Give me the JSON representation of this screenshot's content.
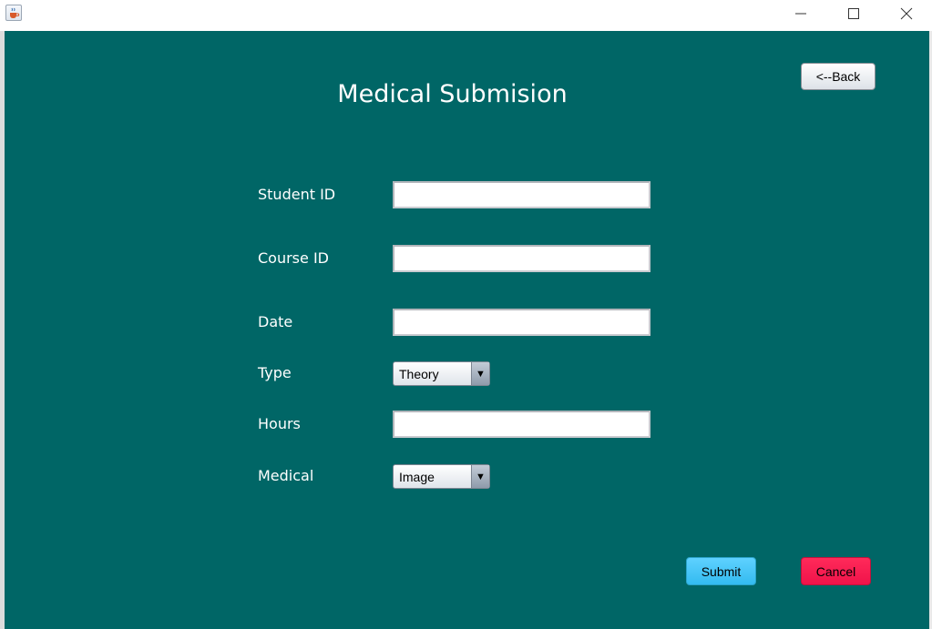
{
  "window": {
    "icon": "java-cup-icon",
    "controls": [
      "minimize-icon",
      "maximize-icon",
      "close-icon"
    ]
  },
  "form": {
    "title": "Medical Submision",
    "back_label": "<--Back",
    "labels": {
      "student_id": "Student ID",
      "course_id": "Course ID",
      "date": "Date",
      "type": "Type",
      "hours": "Hours",
      "medical": "Medical"
    },
    "values": {
      "student_id": "",
      "course_id": "",
      "date": "",
      "hours": ""
    },
    "type_selected": "Theory",
    "medical_selected": "Image",
    "dropdown_arrow": "▼",
    "submit_label": "Submit",
    "cancel_label": "Cancel"
  },
  "colors": {
    "panel_background": "#006666",
    "submit_button": "#40C4F5",
    "cancel_button": "#F5194E"
  }
}
